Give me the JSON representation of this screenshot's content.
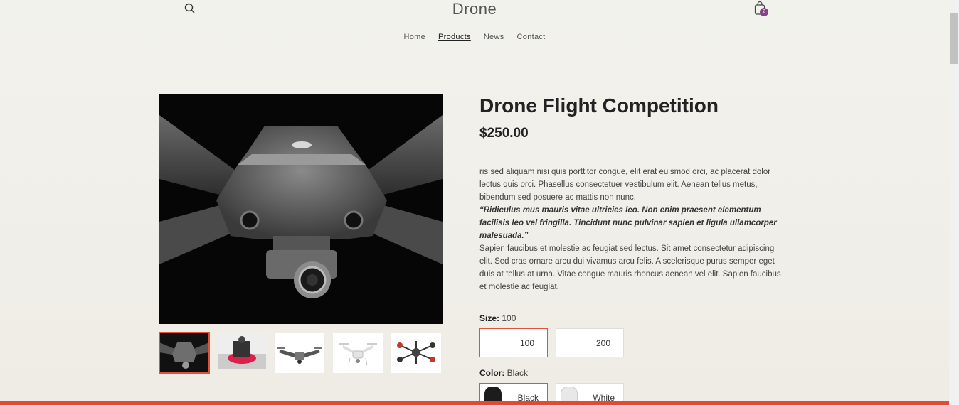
{
  "header": {
    "brand": "Drone",
    "search_icon": "search-icon",
    "cart_icon": "shopping-bag-icon",
    "cart_count": "2"
  },
  "nav": {
    "items": [
      {
        "label": "Home",
        "active": false
      },
      {
        "label": "Products",
        "active": true
      },
      {
        "label": "News",
        "active": false
      },
      {
        "label": "Contact",
        "active": false
      }
    ]
  },
  "product": {
    "title": "Drone Flight Competition",
    "price": "$250.00",
    "description": {
      "p1": "ris sed aliquam nisi quis porttitor congue, elit erat euismod orci, ac placerat dolor lectus quis orci. Phasellus consectetuer vestibulum elit. Aenean tellus metus, bibendum sed posuere ac mattis non nunc.",
      "quote": "“Ridiculus mus mauris vitae ultricies leo. Non enim praesent elementum facilisis leo vel fringilla. Tincidunt nunc pulvinar sapien et ligula ullamcorper malesuada.”",
      "p2": "Sapien faucibus et molestie ac feugiat sed lectus. Sit amet consectetur adipiscing elit. Sed cras ornare arcu dui vivamus arcu felis. A scelerisque purus semper eget duis at tellus at urna. Vitae congue mauris rhoncus aenean vel elit. Sapien faucibus et molestie ac feugiat."
    },
    "size": {
      "label": "Size:",
      "selected": "100",
      "options": [
        "100",
        "200"
      ]
    },
    "color": {
      "label": "Color:",
      "selected": "Black",
      "options": [
        "Black",
        "White"
      ]
    }
  },
  "colors": {
    "accent": "#e24a33",
    "badge": "#8a3f8b",
    "background": "#efece6"
  }
}
